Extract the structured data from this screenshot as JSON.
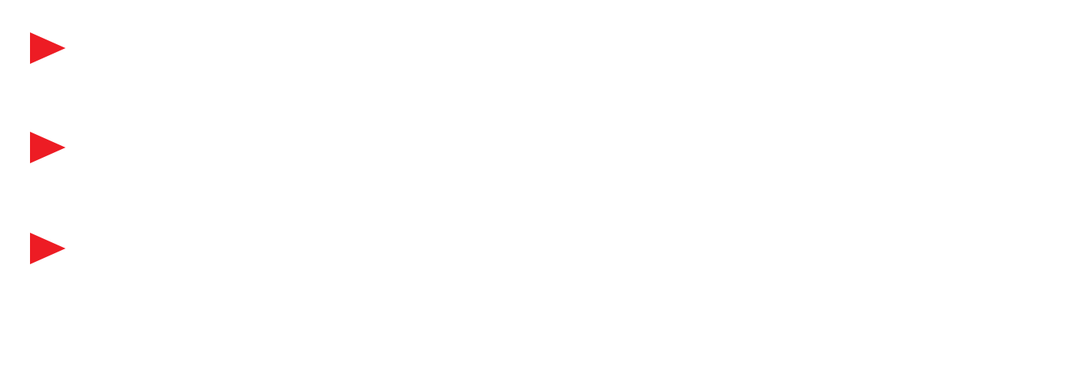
{
  "markers": [
    {
      "icon": "play-triangle-icon",
      "color": "#ED1C24"
    },
    {
      "icon": "play-triangle-icon",
      "color": "#ED1C24"
    },
    {
      "icon": "play-triangle-icon",
      "color": "#ED1C24"
    }
  ]
}
